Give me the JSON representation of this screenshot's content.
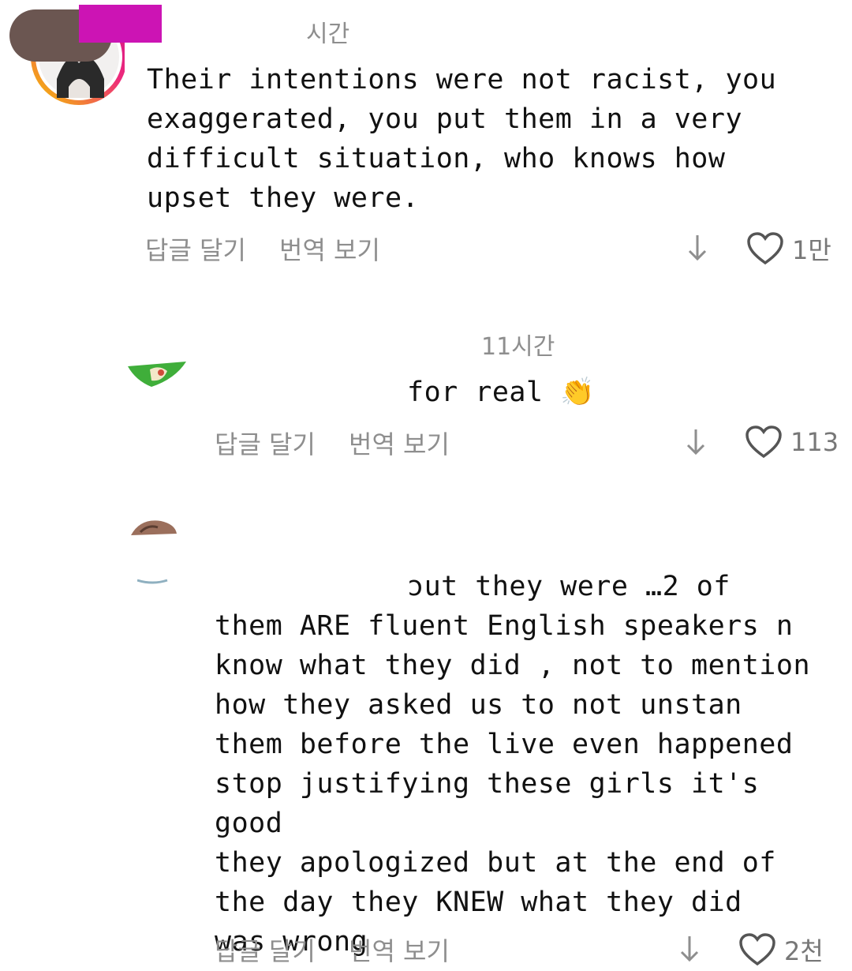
{
  "comments": [
    {
      "time": "시간",
      "text": "Their intentions were not racist, you\nexaggerated, you put them in a very\ndifficult situation, who knows how\nupset they were.",
      "reply_label": "답글 달기",
      "translate_label": "번역 보기",
      "like_count": "1만"
    },
    {
      "time": "11시간",
      "text": "for real 👏",
      "reply_label": "답글 달기",
      "translate_label": "번역 보기",
      "like_count": "113"
    },
    {
      "text_first": "ɔut they were …2 of",
      "text": "them ARE fluent English speakers n\nknow what they did , not to mention\nhow they asked us to not unstan\nthem before the live even happened\nstop justifying these girls it's good\nthey apologized but at the end of\nthe day they KNEW what they did\nwas wrong",
      "reply_label": "답글 달기",
      "translate_label": "번역 보기",
      "like_count": "2천"
    }
  ],
  "icons": {
    "down": "arrow-down-icon",
    "like": "heart-outline-icon"
  },
  "colors": {
    "muted": "#8e8e8e",
    "redaction_pink": "#cc14b4",
    "ring_gradient_start": "#f5c400",
    "ring_gradient_end": "#d1168b"
  }
}
